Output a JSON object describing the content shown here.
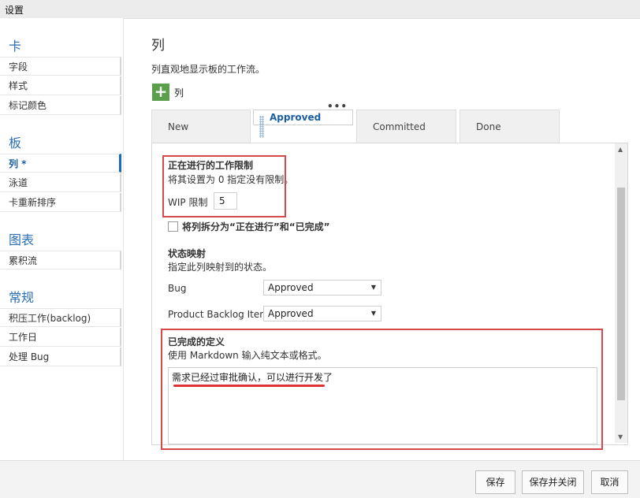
{
  "window": {
    "title": "设置"
  },
  "sidebar": {
    "groups": [
      {
        "title": "卡",
        "items": [
          "字段",
          "样式",
          "标记颜色"
        ]
      },
      {
        "title": "板",
        "items": [
          "列 *",
          "泳道",
          "卡重新排序"
        ]
      },
      {
        "title": "图表",
        "items": [
          "累积流"
        ]
      },
      {
        "title": "常规",
        "items": [
          "积压工作(backlog)",
          "工作日",
          "处理 Bug"
        ]
      }
    ]
  },
  "main": {
    "title": "列",
    "description": "列直观地显示板的工作流。",
    "add_label": "列",
    "tabs": [
      "New",
      "Approved",
      "Committed",
      "Done"
    ],
    "tab_menu": "•••",
    "wip": {
      "heading": "正在进行的工作限制",
      "hint": "将其设置为 0 指定没有限制。",
      "label": "WIP 限制",
      "value": "5"
    },
    "split_label": "将列拆分为“正在进行”和“已完成”",
    "state_mapping": {
      "heading": "状态映射",
      "hint": "指定此列映射到的状态。",
      "rows": [
        {
          "label": "Bug",
          "value": "Approved"
        },
        {
          "label": "Product Backlog Item",
          "value": "Approved"
        }
      ]
    },
    "definition": {
      "heading": "已完成的定义",
      "hint": "使用 Markdown 输入纯文本或格式。",
      "text": "需求已经过审批确认，可以进行开发了"
    }
  },
  "footer": {
    "save": "保存",
    "save_close": "保存并关闭",
    "cancel": "取消"
  },
  "colors": {
    "accent": "#1a5fa5",
    "add_button": "#5aa04b",
    "annotation": "#d84a4a"
  }
}
